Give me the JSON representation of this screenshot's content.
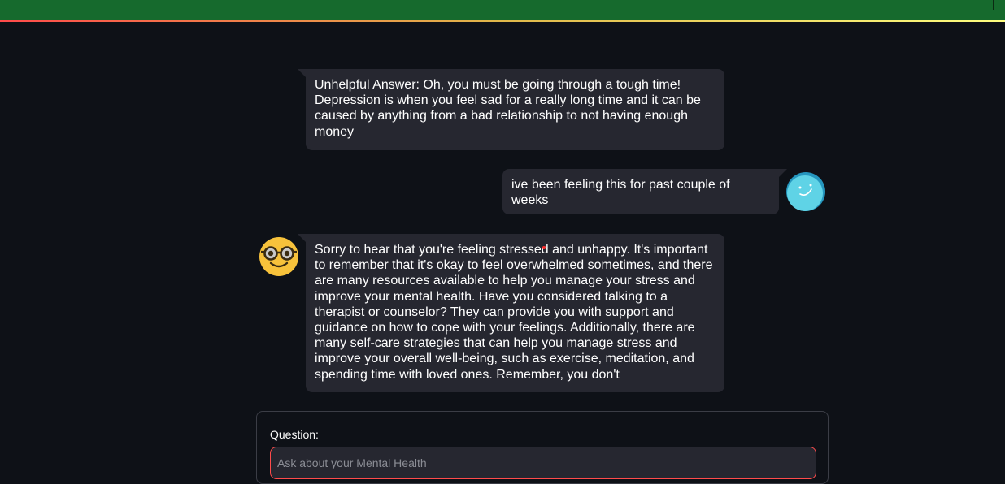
{
  "header": {
    "bar_color": "#166a2d",
    "accent_line": [
      "#ff4b4b",
      "#e0b84a",
      "#ffff80"
    ]
  },
  "messages": [
    {
      "role": "assistant",
      "text": "Unhelpful Answer: Oh, you must be going through a tough time! Depression is when you feel sad for a really long time and it can be caused by anything from a bad relationship to not having enough money"
    },
    {
      "role": "user",
      "text": "ive been feeling this for past couple of weeks",
      "avatar_icon": "smiley-user-avatar-icon"
    },
    {
      "role": "assistant",
      "text": "Sorry to hear that you're feeling stressed and unhappy. It's important to remember that it's okay to feel overwhelmed sometimes, and there are many resources available to help you manage your stress and improve your mental health. Have you considered talking to a therapist or counselor? They can provide you with support and guidance on how to cope with your feelings. Additionally, there are many self-care strategies that can help you manage stress and improve your overall well-being, such as exercise, meditation, and spending time with loved ones. Remember, you don't",
      "avatar_icon": "nerd-face-bot-avatar-icon"
    }
  ],
  "form": {
    "label": "Question:",
    "placeholder": "Ask about your Mental Health",
    "value": ""
  },
  "colors": {
    "background": "#0e1117",
    "bubble": "#262730",
    "input_border": "#ff4b4b"
  }
}
